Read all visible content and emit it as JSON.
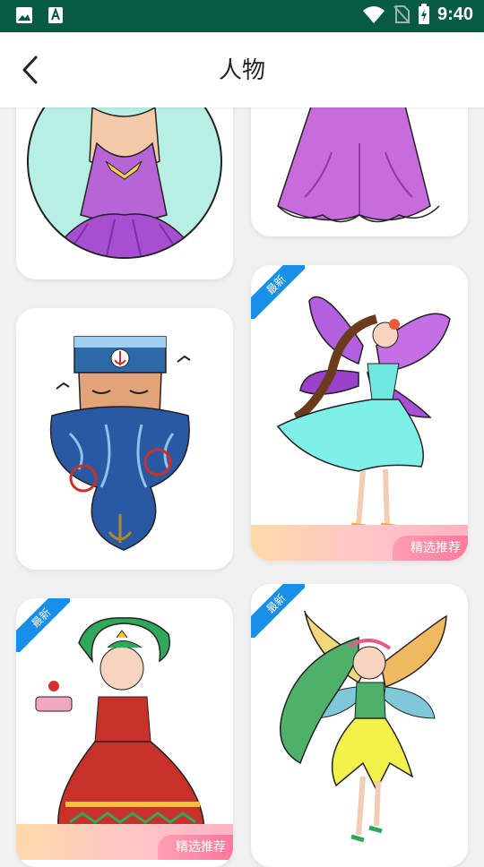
{
  "status_bar": {
    "time": "9:40",
    "icons": [
      "image-icon",
      "text-a-icon",
      "wifi-icon",
      "no-sim-icon",
      "battery-charging-icon"
    ]
  },
  "app_bar": {
    "title": "人物",
    "back_icon": "chevron-left-icon"
  },
  "badges": {
    "new": "最新",
    "recommended": "精选推荐"
  },
  "cards": [
    {
      "subject": "woman in purple dress circle portrait",
      "new": false,
      "recommended": false
    },
    {
      "subject": "purple gown",
      "new": false,
      "recommended": false
    },
    {
      "subject": "bearded sailor with anchor",
      "new": false,
      "recommended": false
    },
    {
      "subject": "fairy with purple wings",
      "new": true,
      "recommended": true
    },
    {
      "subject": "princess with cake",
      "new": true,
      "recommended": true
    },
    {
      "subject": "green haired fairy",
      "new": true,
      "recommended": false
    }
  ],
  "colors": {
    "status_bar": "#075a44",
    "ribbon": "#1890e8",
    "recommend_pink": "#ff7a9a"
  }
}
